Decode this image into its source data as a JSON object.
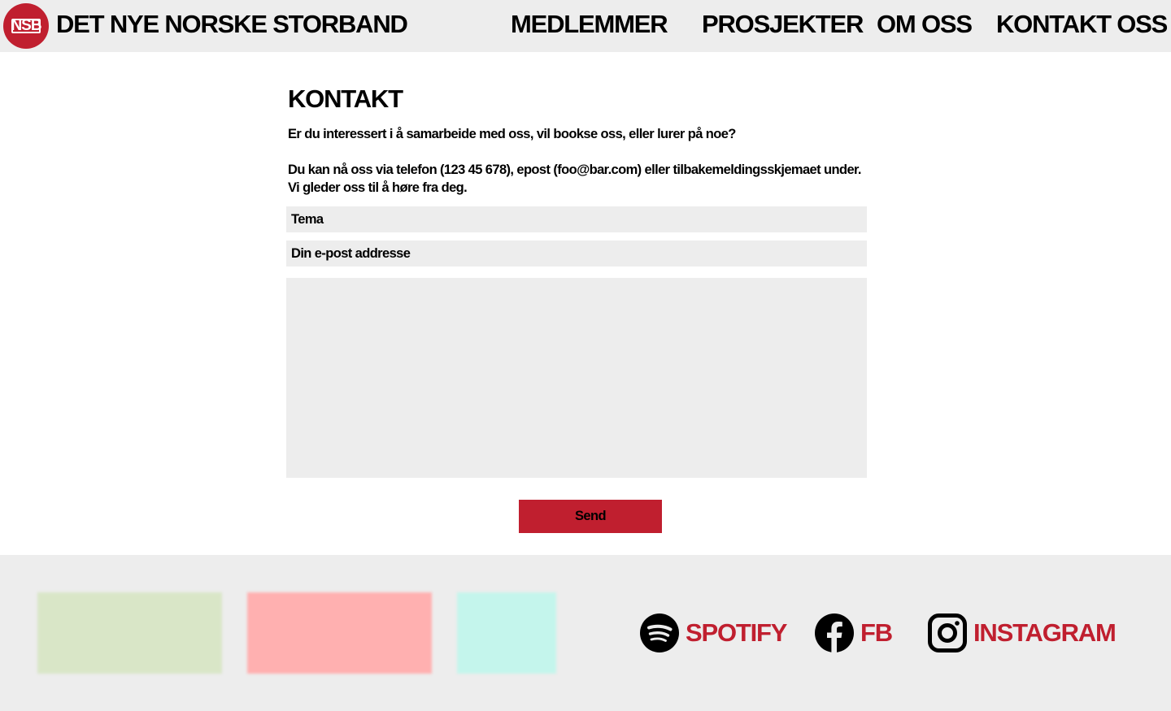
{
  "header": {
    "logo_text": "NSB",
    "brand": "DET NYE NORSKE STORBAND",
    "nav": [
      "MEDLEMMER",
      "PROSJEKTER",
      "OM OSS",
      "KONTAKT OSS"
    ]
  },
  "contact": {
    "title": "KONTAKT",
    "intro": "Er du interessert i å samarbeide med oss, vil bookse oss, eller lurer på noe?",
    "details": "Du kan nå oss via telefon (123 45 678), epost (foo@bar.com) eller tilbakemeldingsskjemaet under. Vi gleder oss til å høre fra deg.",
    "topic_placeholder": "Tema",
    "email_placeholder": "Din e-post addresse",
    "message_value": "",
    "send_label": "Send"
  },
  "footer": {
    "swatches": [
      "#d9e6c7",
      "#ffb0b0",
      "#c4f5ec"
    ],
    "social": [
      {
        "label": "SPOTIFY",
        "icon": "spotify-icon"
      },
      {
        "label": "FB",
        "icon": "facebook-icon"
      },
      {
        "label": "INSTAGRAM",
        "icon": "instagram-icon"
      }
    ]
  },
  "colors": {
    "accent": "#c01f2f",
    "background_gray": "#ededed",
    "text": "#000000"
  }
}
